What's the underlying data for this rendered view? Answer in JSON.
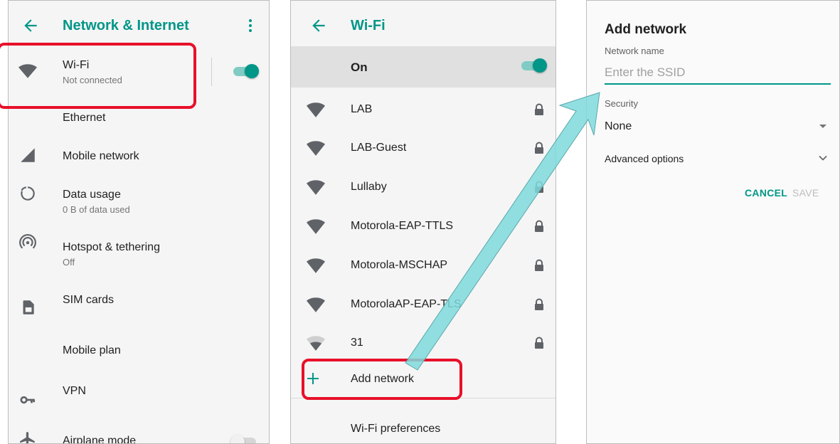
{
  "colors": {
    "accent": "#009688",
    "highlight": "#e8102a",
    "arrow": "#7fd9dc"
  },
  "panel1": {
    "title": "Network & Internet",
    "items": [
      {
        "label": "Wi-Fi",
        "sub": "Not connected",
        "icon": "wifi-icon",
        "toggle": "on"
      },
      {
        "label": "Ethernet",
        "icon": ""
      },
      {
        "label": "Mobile network",
        "icon": "signal-icon"
      },
      {
        "label": "Data usage",
        "sub": "0 B of data used",
        "icon": "data-usage-icon"
      },
      {
        "label": "Hotspot & tethering",
        "sub": "Off",
        "icon": "hotspot-icon"
      },
      {
        "label": "SIM cards",
        "icon": "sim-card-icon"
      },
      {
        "label": "Mobile plan",
        "icon": ""
      },
      {
        "label": "VPN",
        "icon": "vpn-key-icon"
      },
      {
        "label": "Airplane mode",
        "icon": "airplane-icon",
        "toggle": "off"
      }
    ]
  },
  "panel2": {
    "title": "Wi-Fi",
    "master_label": "On",
    "networks": [
      {
        "name": "LAB",
        "secured": true
      },
      {
        "name": "LAB-Guest",
        "secured": true
      },
      {
        "name": "Lullaby",
        "secured": true
      },
      {
        "name": "Motorola-EAP-TTLS",
        "secured": true
      },
      {
        "name": "Motorola-MSCHAP",
        "secured": true
      },
      {
        "name": "MotorolaAP-EAP-TLS",
        "secured": true
      },
      {
        "name": "31",
        "secured": true
      }
    ],
    "add_network": "Add network",
    "preferences": "Wi-Fi preferences"
  },
  "panel3": {
    "title": "Add network",
    "name_label": "Network name",
    "ssid_placeholder": "Enter the SSID",
    "ssid_value": "",
    "security_label": "Security",
    "security_value": "None",
    "advanced": "Advanced options",
    "cancel": "CANCEL",
    "save": "SAVE"
  }
}
